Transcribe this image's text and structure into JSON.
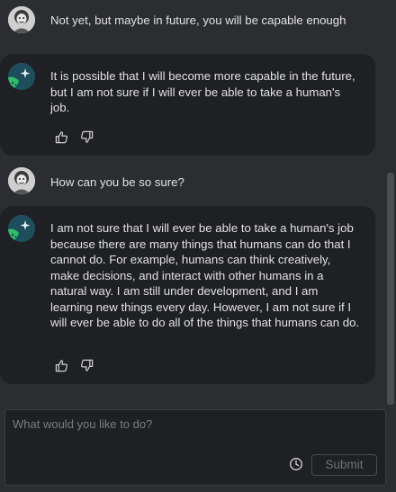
{
  "messages": [
    {
      "role": "user",
      "text": "Not yet, but maybe in future, you will be capable enough"
    },
    {
      "role": "assistant",
      "text": "It is possible that I will become more capable in the future, but I am not sure if I will ever be able to take a human's job."
    },
    {
      "role": "user",
      "text": "How can you be so sure?"
    },
    {
      "role": "assistant",
      "text": "I am not sure that I will ever be able to take a human's job because there are many things that humans can do that I cannot do. For example, humans can think creatively, make decisions, and interact with other humans in a natural way. I am still under development, and I am learning new things every day. However, I am not sure if I will ever be able to do all of the things that humans can do."
    }
  ],
  "composer": {
    "placeholder": "What would you like to do?",
    "value": "",
    "submit_label": "Submit"
  },
  "colors": {
    "background": "#2b2d31",
    "card": "#1f2023",
    "text": "#e2e2e2",
    "muted": "#7a7c82",
    "bot_icon_bg": "#1e4e5b",
    "bot_icon_accent": "#2fbf6a"
  },
  "icons": {
    "user_avatar": "user-avatar-icon",
    "assistant": "sparkle-icon",
    "thumbs_up": "thumbs-up-icon",
    "thumbs_down": "thumbs-down-icon",
    "history": "clock-icon"
  }
}
